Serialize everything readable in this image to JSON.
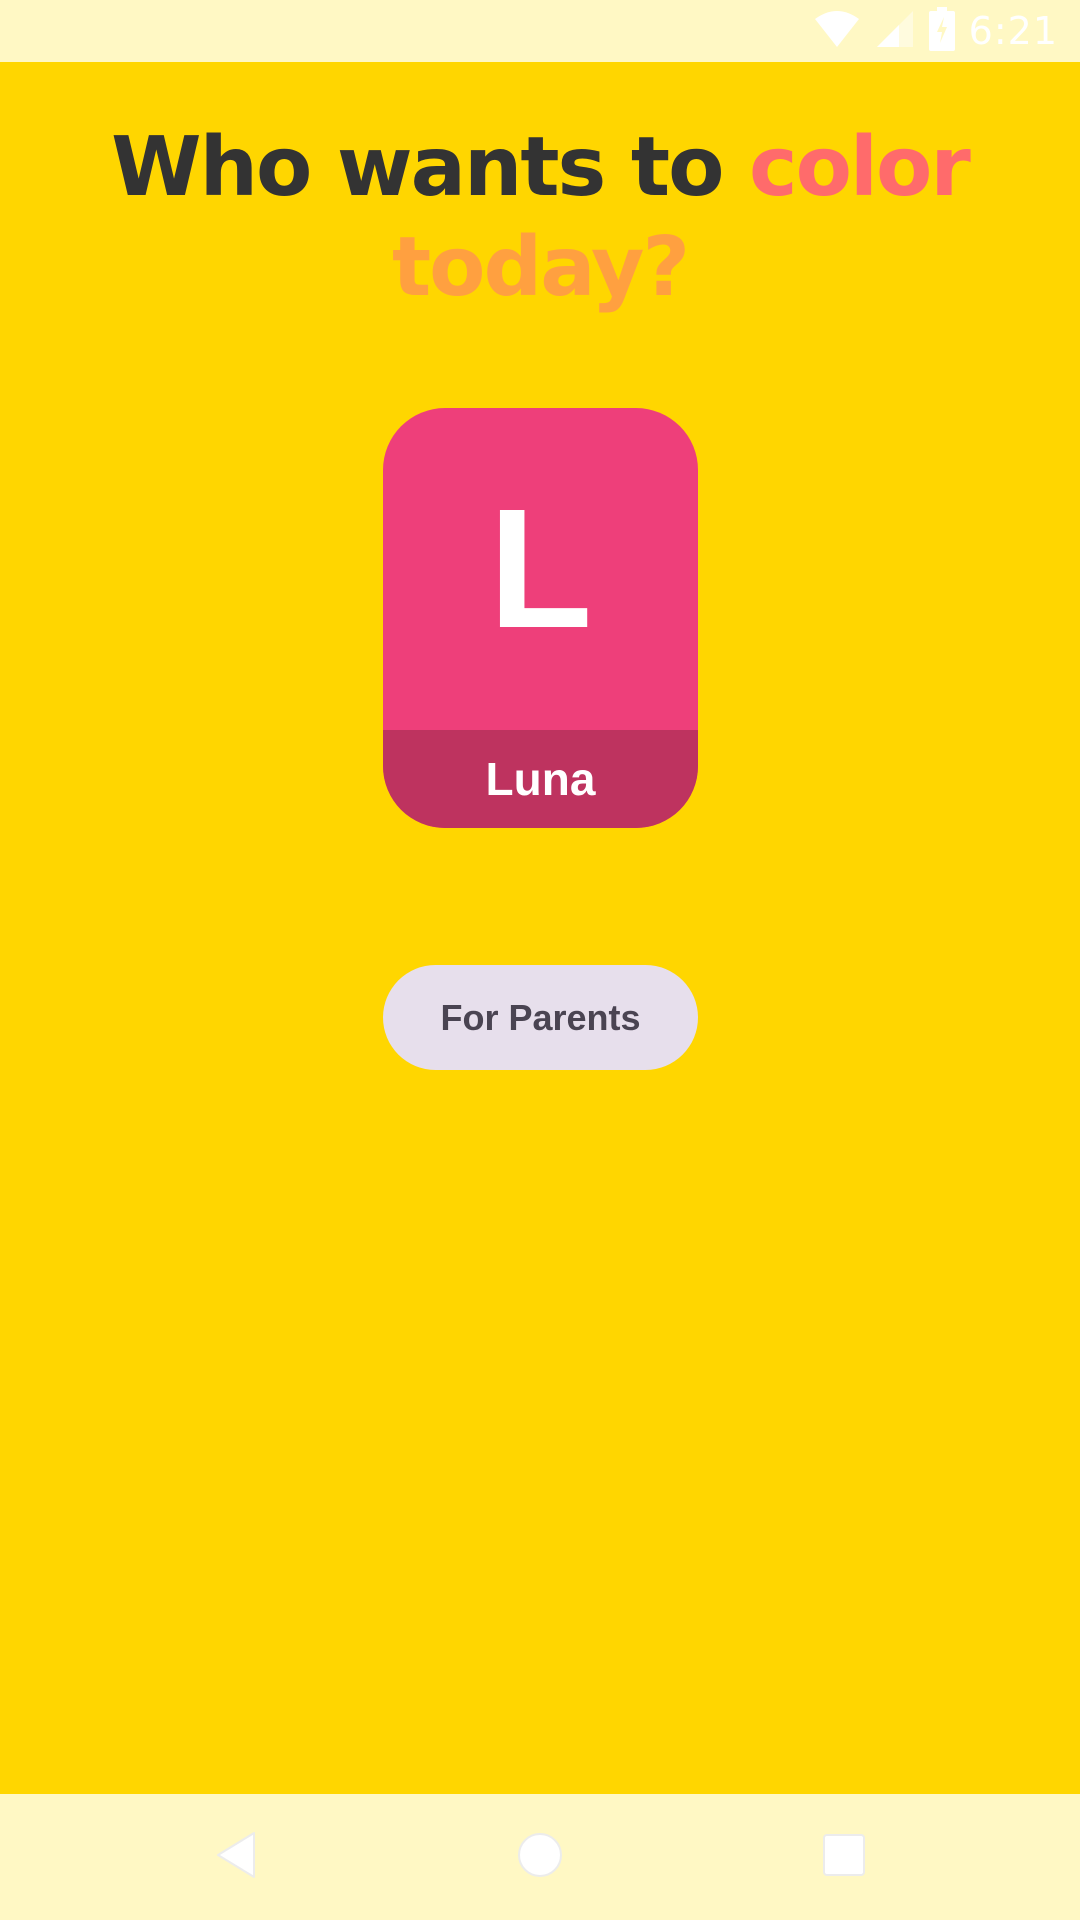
{
  "status_bar": {
    "time": "6:21",
    "icons": [
      "wifi-icon",
      "signal-icon",
      "battery-charging-icon"
    ]
  },
  "headline": {
    "part1": "Who wants to ",
    "part2": "color",
    "part3": "today?"
  },
  "profiles": [
    {
      "initial": "L",
      "name": "Luna"
    }
  ],
  "parents_button": {
    "label": "For Parents"
  },
  "nav_bar": {
    "icons": [
      "back-icon",
      "home-icon",
      "recents-icon"
    ]
  },
  "colors": {
    "background": "#FFD600",
    "system_bars": "#FFF8C4",
    "headline_dark": "#333333",
    "headline_coral": "#FF6B6B",
    "headline_orange": "#FFA040",
    "profile_card": "#EE3F7A",
    "profile_name_bar": "#BE335F",
    "parents_button_bg": "#E7DFEC",
    "parents_button_text": "#4A4452"
  }
}
